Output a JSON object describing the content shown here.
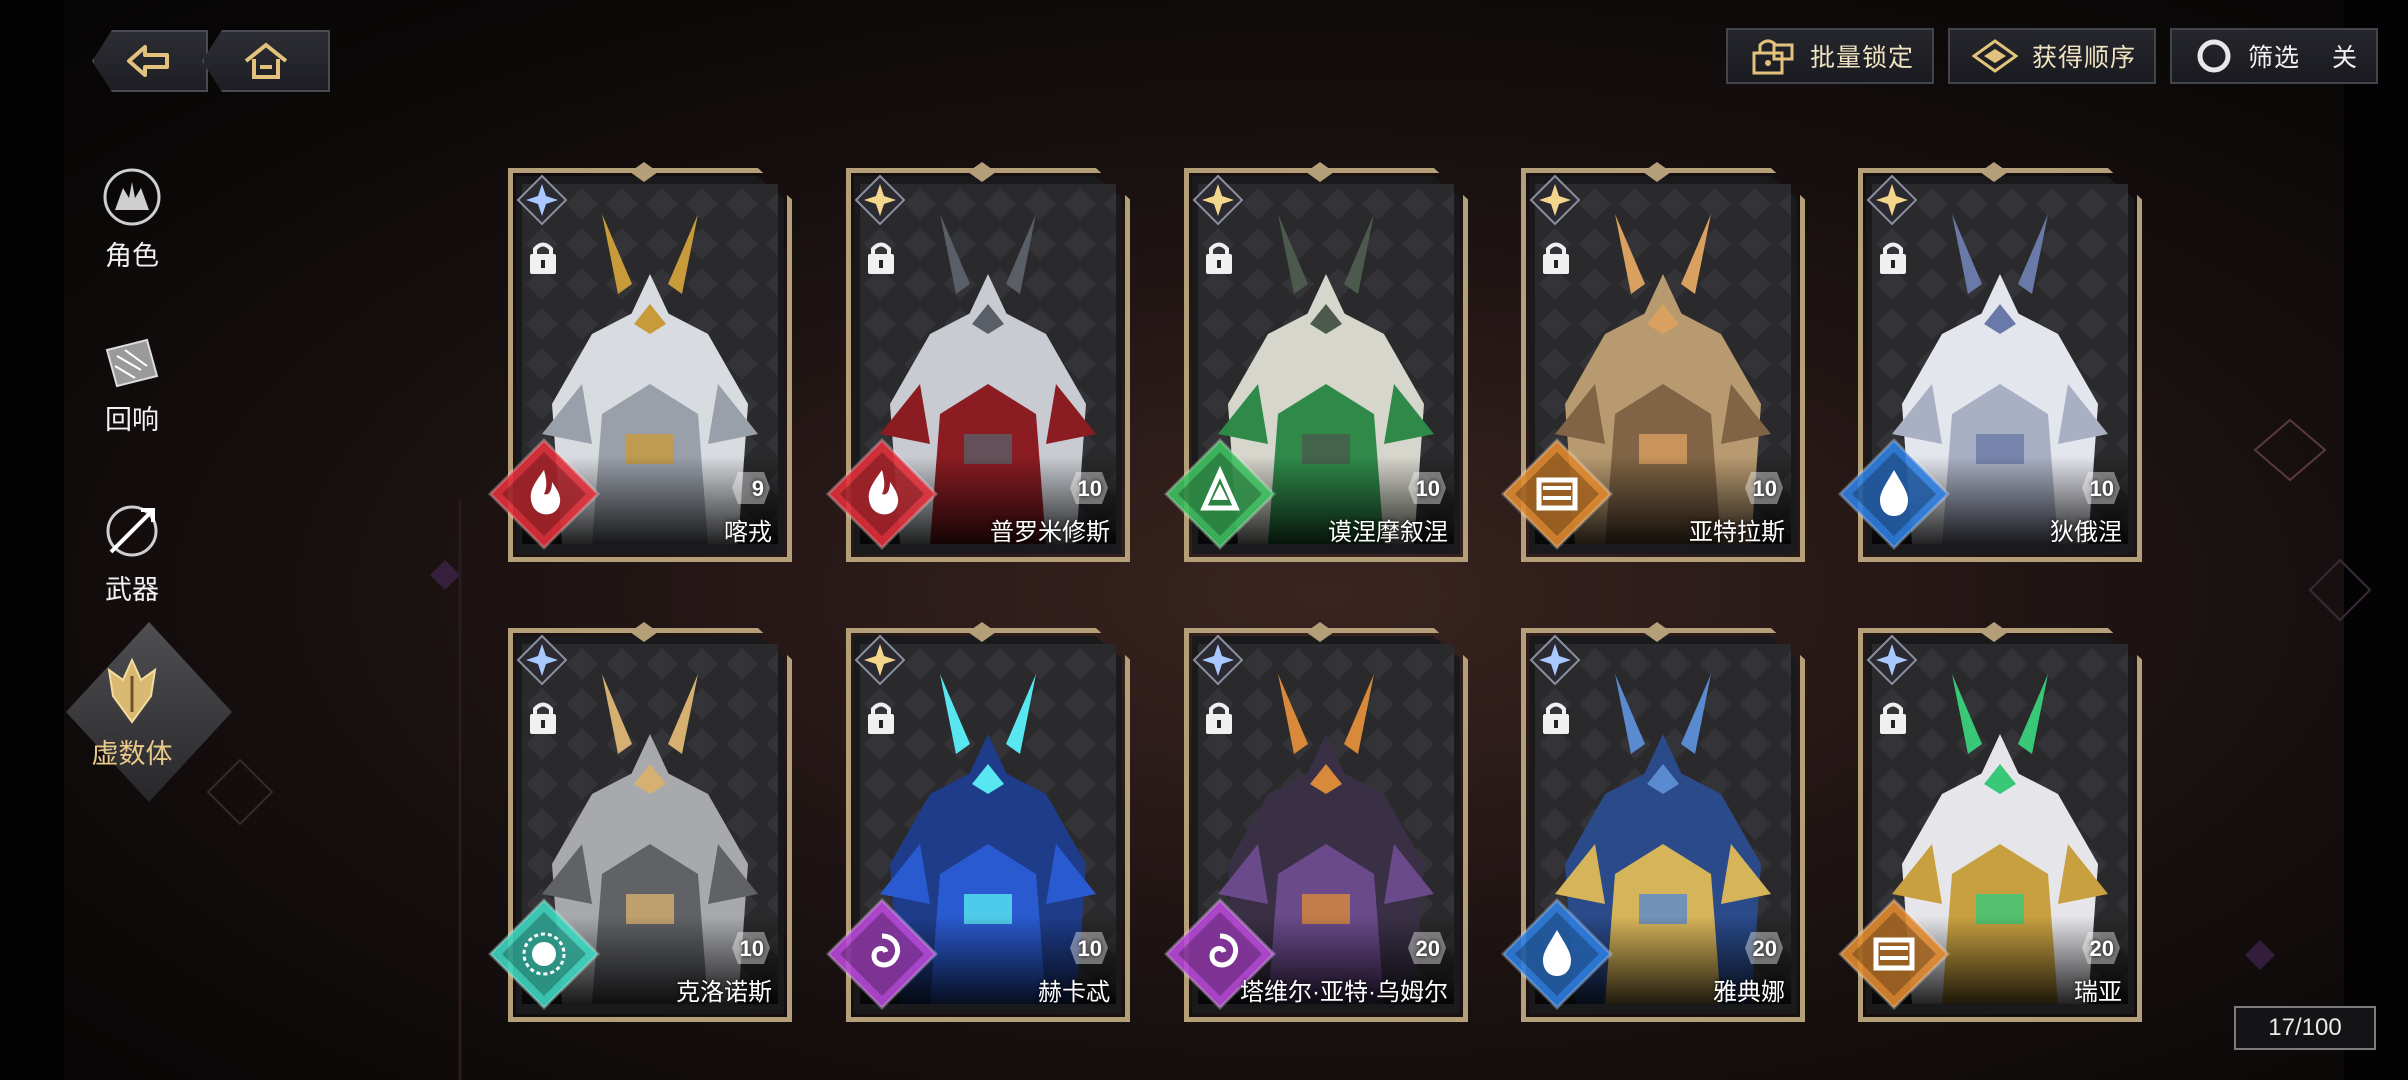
{
  "nav": {
    "back_icon": "back-arrow-icon",
    "home_icon": "home-icon"
  },
  "toolbar": {
    "batch_lock": "批量锁定",
    "acquire_order": "获得顺序",
    "filter": "筛选",
    "filter_state": "关"
  },
  "sidebar": {
    "items": [
      {
        "label": "角色",
        "icon": "character-icon"
      },
      {
        "label": "回响",
        "icon": "echo-icon"
      },
      {
        "label": "武器",
        "icon": "weapon-icon"
      },
      {
        "label": "虚数体",
        "icon": "imaginary-icon",
        "active": true
      }
    ]
  },
  "cards": [
    {
      "name": "喀戎",
      "level": "9",
      "element": "fire",
      "color": "#e0303a"
    },
    {
      "name": "普罗米修斯",
      "level": "10",
      "element": "fire",
      "color": "#e0303a"
    },
    {
      "name": "谟涅摩叙涅",
      "level": "10",
      "element": "wind",
      "color": "#3fc060"
    },
    {
      "name": "亚特拉斯",
      "level": "10",
      "element": "earth",
      "color": "#e08a30"
    },
    {
      "name": "狄俄涅",
      "level": "10",
      "element": "water",
      "color": "#2f7ee0"
    },
    {
      "name": "克洛诺斯",
      "level": "10",
      "element": "light",
      "color": "#3fd6c0"
    },
    {
      "name": "赫卡忒",
      "level": "10",
      "element": "dark",
      "color": "#b84ad8"
    },
    {
      "name": "塔维尔·亚特·乌姆尔",
      "level": "20",
      "element": "dark",
      "color": "#b84ad8"
    },
    {
      "name": "雅典娜",
      "level": "20",
      "element": "water",
      "color": "#2f7ee0"
    },
    {
      "name": "瑞亚",
      "level": "20",
      "element": "earth",
      "color": "#e08a30"
    }
  ],
  "count": "17/100"
}
